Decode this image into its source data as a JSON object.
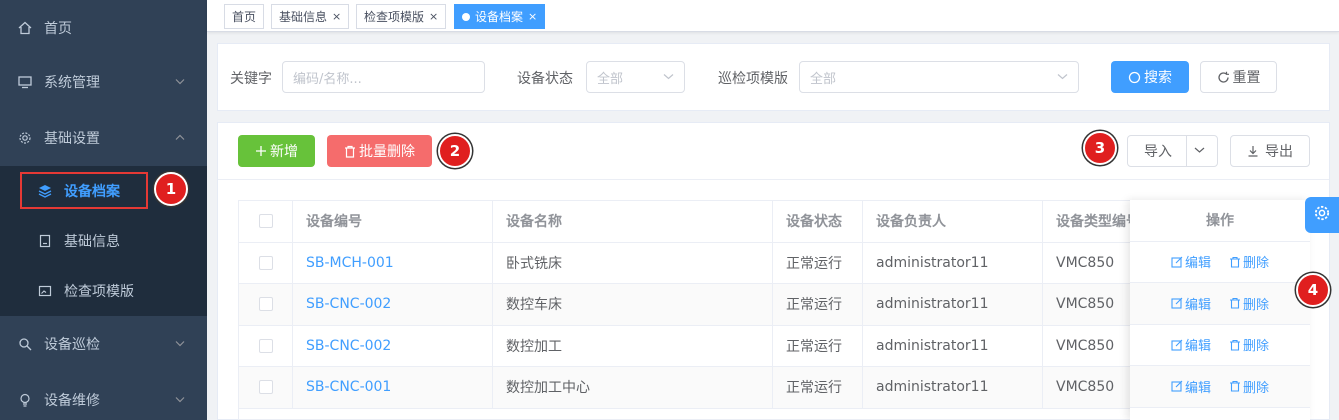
{
  "sidebar": {
    "items": [
      {
        "label": "首页",
        "icon": "home-icon"
      },
      {
        "label": "系统管理",
        "icon": "monitor-icon"
      },
      {
        "label": "基础设置",
        "icon": "gear-icon"
      },
      {
        "label": "设备巡检",
        "icon": "search-icon"
      },
      {
        "label": "设备维修",
        "icon": "bulb-icon"
      }
    ],
    "submenu": [
      {
        "label": "设备档案",
        "icon": "layers-icon"
      },
      {
        "label": "基础信息",
        "icon": "document-icon"
      },
      {
        "label": "检查项模版",
        "icon": "image-icon"
      }
    ]
  },
  "tags": [
    {
      "label": "首页"
    },
    {
      "label": "基础信息",
      "close": "×"
    },
    {
      "label": "检查项模版",
      "close": "×"
    },
    {
      "label": "设备档案",
      "close": "×"
    }
  ],
  "search": {
    "keyword_label": "关键字",
    "keyword_placeholder": "编码/名称...",
    "status_label": "设备状态",
    "status_value": "全部",
    "template_label": "巡检项模版",
    "template_value": "全部",
    "search_btn": "搜索",
    "reset_btn": "重置"
  },
  "toolbar": {
    "add_btn": "新增",
    "batch_delete_btn": "批量删除",
    "import_btn": "导入",
    "export_btn": "导出"
  },
  "table": {
    "headers": [
      "设备编号",
      "设备名称",
      "设备状态",
      "设备负责人",
      "设备类型编号",
      "操作"
    ],
    "rows": [
      {
        "code": "SB-MCH-001",
        "name": "卧式铣床",
        "status": "正常运行",
        "owner": "administrator11",
        "type": "VMC850"
      },
      {
        "code": "SB-CNC-002",
        "name": "数控车床",
        "status": "正常运行",
        "owner": "administrator11",
        "type": "VMC850"
      },
      {
        "code": "SB-CNC-002",
        "name": "数控加工",
        "status": "正常运行",
        "owner": "administrator11",
        "type": "VMC850"
      },
      {
        "code": "SB-CNC-001",
        "name": "数控加工中心",
        "status": "正常运行",
        "owner": "administrator11",
        "type": "VMC850"
      }
    ],
    "edit_label": "编辑",
    "delete_label": "删除"
  },
  "badges": [
    "1",
    "2",
    "3",
    "4"
  ],
  "colors": {
    "primary": "#409eff",
    "success": "#67c23a",
    "danger": "#f56c6c",
    "sidebar_bg": "#304156",
    "submenu_bg": "#1f2d3d",
    "badge": "#e01f1f"
  }
}
